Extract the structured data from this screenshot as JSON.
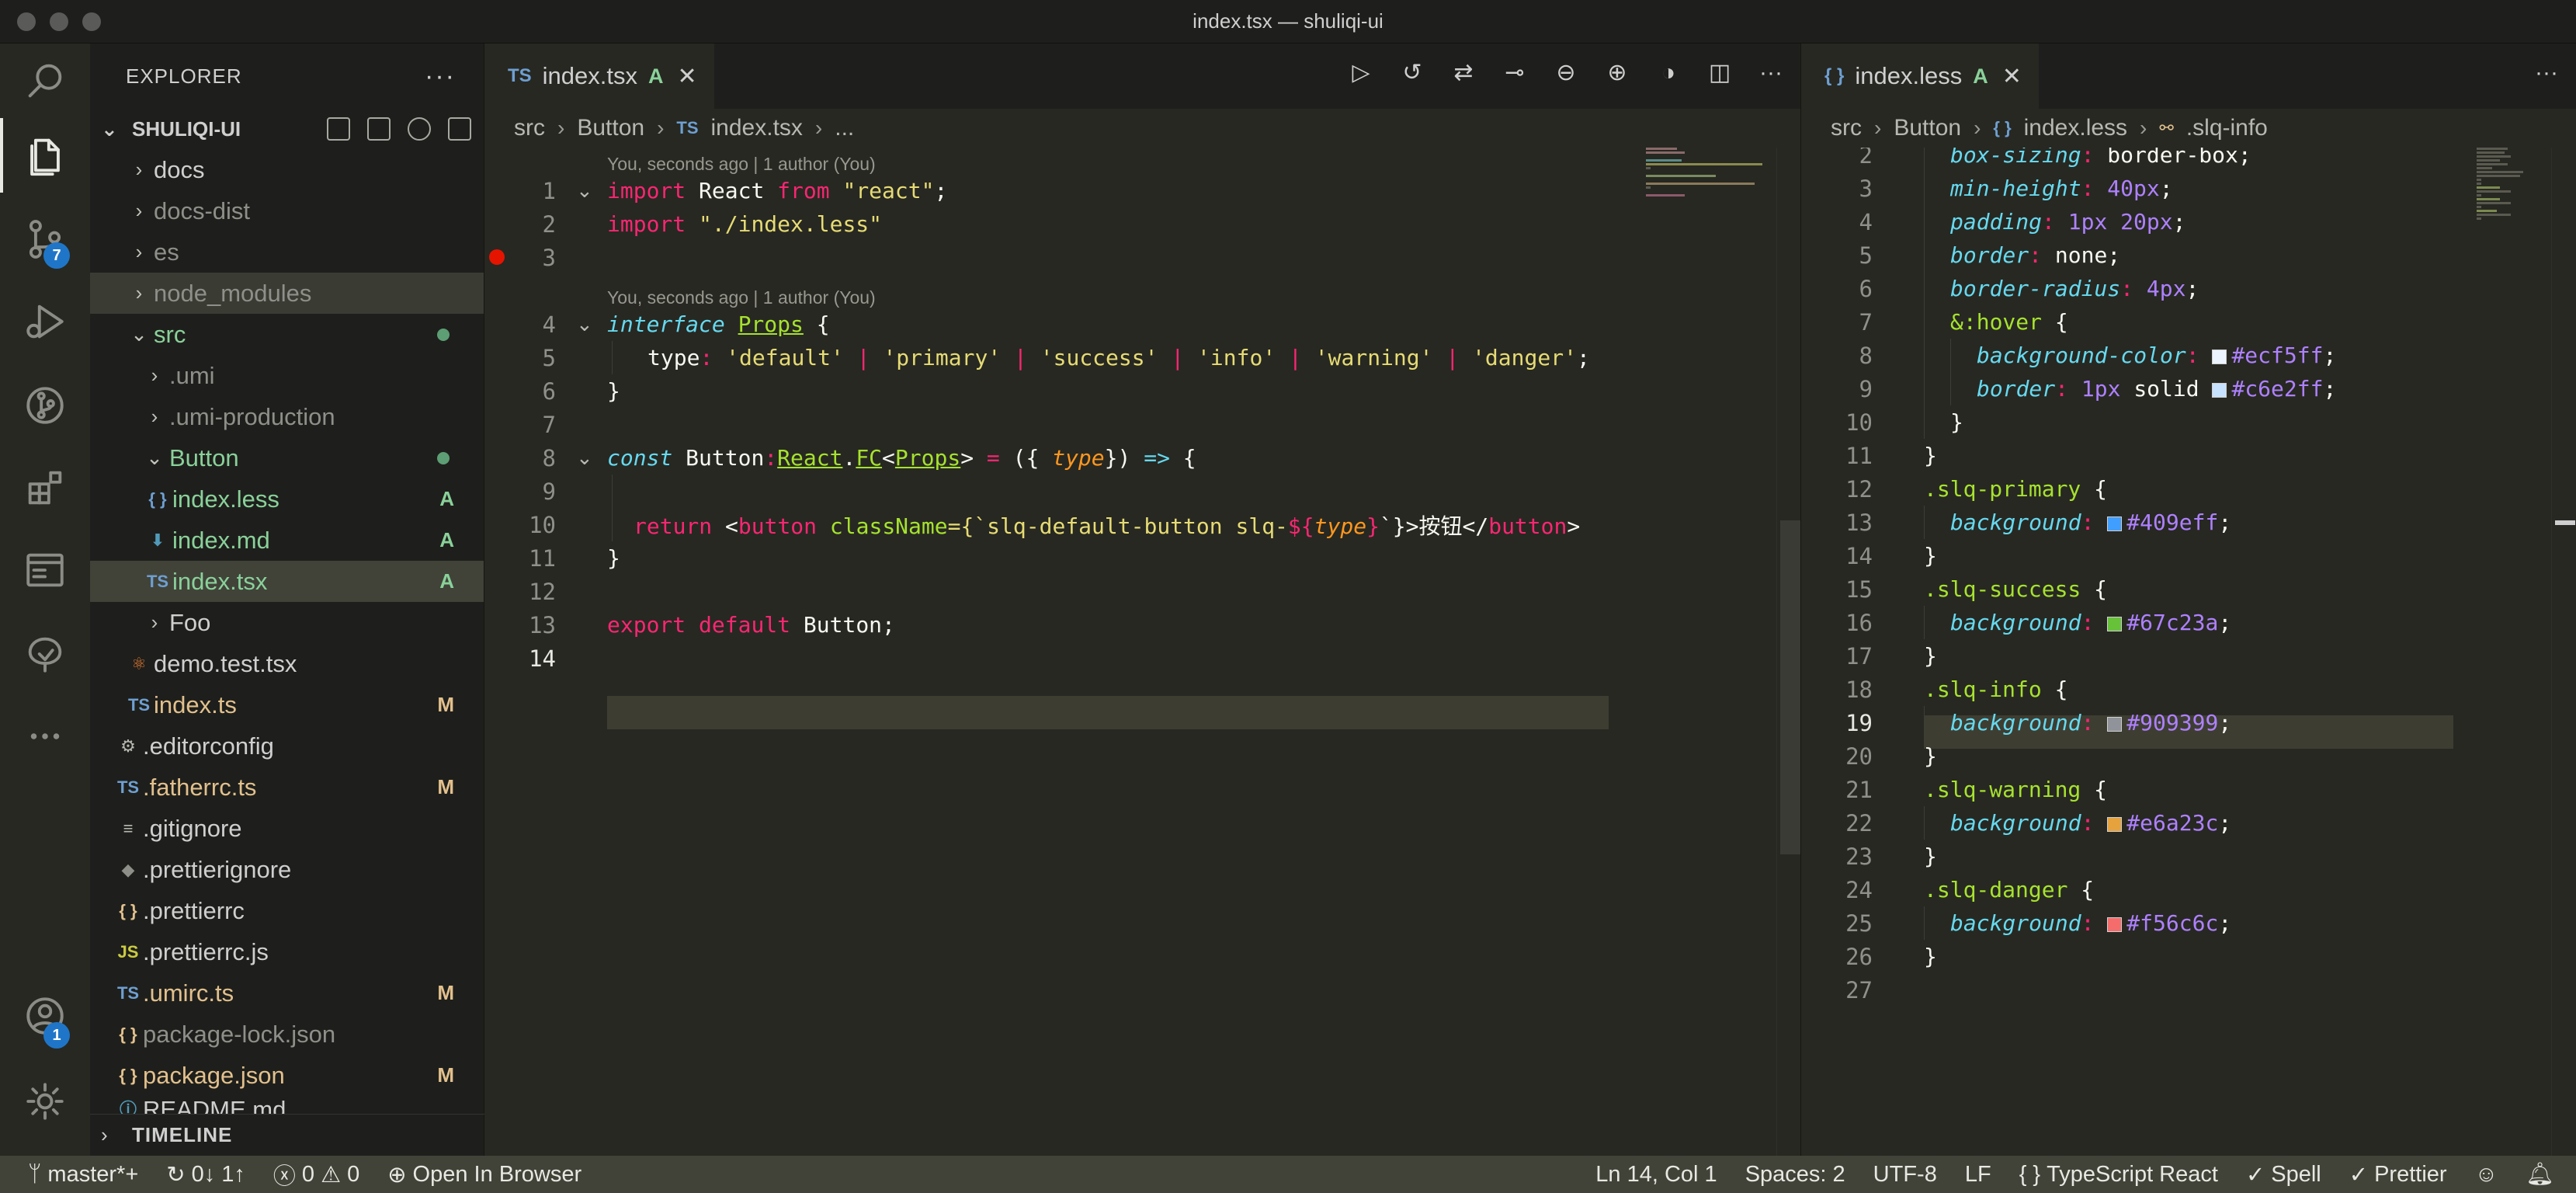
{
  "window": {
    "title": "index.tsx — shuliqi-ui"
  },
  "activity_bar": {
    "items": [
      {
        "name": "search-icon"
      },
      {
        "name": "explorer-icon"
      },
      {
        "name": "source-control-icon",
        "badge": "7"
      },
      {
        "name": "run-debug-icon"
      },
      {
        "name": "git-graph-icon"
      },
      {
        "name": "extensions-icon"
      },
      {
        "name": "remote-explorer-icon"
      },
      {
        "name": "tree-icon"
      },
      {
        "name": "more-icon"
      }
    ],
    "account_badge": "1"
  },
  "sidebar": {
    "title": "EXPLORER",
    "project": "SHULIQI-UI",
    "items": [
      {
        "label": "docs",
        "type": "folder"
      },
      {
        "label": "docs-dist",
        "type": "folder"
      },
      {
        "label": "es",
        "type": "folder"
      },
      {
        "label": "node_modules",
        "type": "folder"
      },
      {
        "label": "src",
        "type": "folder-open"
      },
      {
        "label": ".umi",
        "type": "folder"
      },
      {
        "label": ".umi-production",
        "type": "folder"
      },
      {
        "label": "Button",
        "type": "folder-open"
      },
      {
        "label": "index.less",
        "icon": "{ }",
        "status": "A"
      },
      {
        "label": "index.md",
        "icon": "⬇",
        "status": "A"
      },
      {
        "label": "index.tsx",
        "icon": "TS",
        "status": "A"
      },
      {
        "label": "Foo",
        "type": "folder"
      },
      {
        "label": "demo.test.tsx",
        "icon": "⚛"
      },
      {
        "label": "index.ts",
        "icon": "TS",
        "status": "M"
      },
      {
        "label": ".editorconfig",
        "icon": "⚙"
      },
      {
        "label": ".fatherrc.ts",
        "icon": "TS",
        "status": "M"
      },
      {
        "label": ".gitignore",
        "icon": "≡"
      },
      {
        "label": ".prettierignore",
        "icon": "◆"
      },
      {
        "label": ".prettierrc",
        "icon": "{ }"
      },
      {
        "label": ".prettierrc.js",
        "icon": "JS"
      },
      {
        "label": ".umirc.ts",
        "icon": "TS",
        "status": "M"
      },
      {
        "label": "package-lock.json",
        "icon": "{ }"
      },
      {
        "label": "package.json",
        "icon": "{ }",
        "status": "M"
      },
      {
        "label": "README.md",
        "icon": "ⓘ"
      }
    ],
    "timeline": "TIMELINE"
  },
  "editor_left": {
    "tab": {
      "icon": "TS",
      "label": "index.tsx",
      "status": "A"
    },
    "breadcrumb": [
      "src",
      "Button",
      "index.tsx",
      "..."
    ],
    "codelens": "You, seconds ago | 1 author (You)",
    "line_numbers": [
      "1",
      "2",
      "3",
      "4",
      "5",
      "6",
      "7",
      "8",
      "9",
      "10",
      "11",
      "12",
      "13",
      "14"
    ],
    "code": {
      "l1": [
        "import",
        " React ",
        "from",
        " ",
        "\"react\"",
        ";"
      ],
      "l2": [
        "import",
        " ",
        "\"./index.less\""
      ],
      "l4": [
        "interface",
        " ",
        "Props",
        " {"
      ],
      "l5": [
        "type",
        ": ",
        "'default'",
        " | ",
        "'primary'",
        " | ",
        "'success'",
        " | ",
        "'info'",
        " | ",
        "'warning'",
        " | ",
        "'danger'",
        ";"
      ],
      "l6": "}",
      "l8": [
        "const",
        " Button",
        ":",
        "React",
        ".",
        "FC",
        "<",
        "Props",
        "> ",
        "=",
        " ({ ",
        "type",
        "}) ",
        "=>",
        " {"
      ],
      "l10": [
        "return",
        " <",
        "button",
        " ",
        "className",
        "={`slq-default-button slq-",
        "${",
        "type",
        "}",
        "`}>按钮</",
        "button",
        ">"
      ],
      "l11": "}",
      "l13": [
        "export",
        " ",
        "default",
        " Button;"
      ]
    }
  },
  "editor_right": {
    "tab": {
      "icon": "{ }",
      "label": "index.less",
      "status": "A"
    },
    "breadcrumb": [
      "src",
      "Button",
      "index.less",
      ".slq-info"
    ],
    "line_numbers": [
      "2",
      "3",
      "4",
      "5",
      "6",
      "7",
      "8",
      "9",
      "10",
      "11",
      "12",
      "13",
      "14",
      "15",
      "16",
      "17",
      "18",
      "19",
      "20",
      "21",
      "22",
      "23",
      "24",
      "25",
      "26",
      "27"
    ],
    "code": {
      "l2": [
        "box-sizing",
        ": ",
        "border-box",
        ";"
      ],
      "l3": [
        "min-height",
        ": ",
        "40px",
        ";"
      ],
      "l4": [
        "padding",
        ": ",
        "1px",
        " ",
        "20px",
        ";"
      ],
      "l5": [
        "border",
        ": ",
        "none",
        ";"
      ],
      "l6": [
        "border-radius",
        ": ",
        "4px",
        ";"
      ],
      "l7": [
        "&:hover",
        " {"
      ],
      "l8": [
        "background-color",
        ": ",
        "#ecf5ff",
        ";"
      ],
      "l9": [
        "border",
        ": ",
        "1px",
        " ",
        "solid",
        " ",
        "#c6e2ff",
        ";"
      ],
      "l10": "}",
      "l11": "}",
      "l12": [
        ".slq-primary",
        " {"
      ],
      "l13": [
        "background",
        ": ",
        "#409eff",
        ";"
      ],
      "l14": "}",
      "l15": [
        ".slq-success",
        " {"
      ],
      "l16": [
        "background",
        ": ",
        "#67c23a",
        ";"
      ],
      "l17": "}",
      "l18": [
        ".slq-info",
        " {"
      ],
      "l19": [
        "background",
        ": ",
        "#909399",
        ";"
      ],
      "l20": "}",
      "l21": [
        ".slq-warning",
        " {"
      ],
      "l22": [
        "background",
        ": ",
        "#e6a23c",
        ";"
      ],
      "l23": "}",
      "l24": [
        ".slq-danger",
        " {"
      ],
      "l25": [
        "background",
        ": ",
        "#f56c6c",
        ";"
      ],
      "l26": "}"
    },
    "swatches": {
      "ecf5ff": "#ecf5ff",
      "c6e2ff": "#c6e2ff",
      "409eff": "#409eff",
      "67c23a": "#67c23a",
      "909399": "#909399",
      "e6a23c": "#e6a23c",
      "f56c6c": "#f56c6c"
    }
  },
  "statusbar": {
    "branch": "master*+",
    "sync": "0↓ 1↑",
    "errors": "0",
    "warnings": "0",
    "open_in_browser": "Open In Browser",
    "position": "Ln 14, Col 1",
    "spaces": "Spaces: 2",
    "encoding": "UTF-8",
    "eol": "LF",
    "language": "TypeScript React",
    "language_icon": "{ }",
    "spell": "Spell",
    "prettier": "Prettier"
  }
}
